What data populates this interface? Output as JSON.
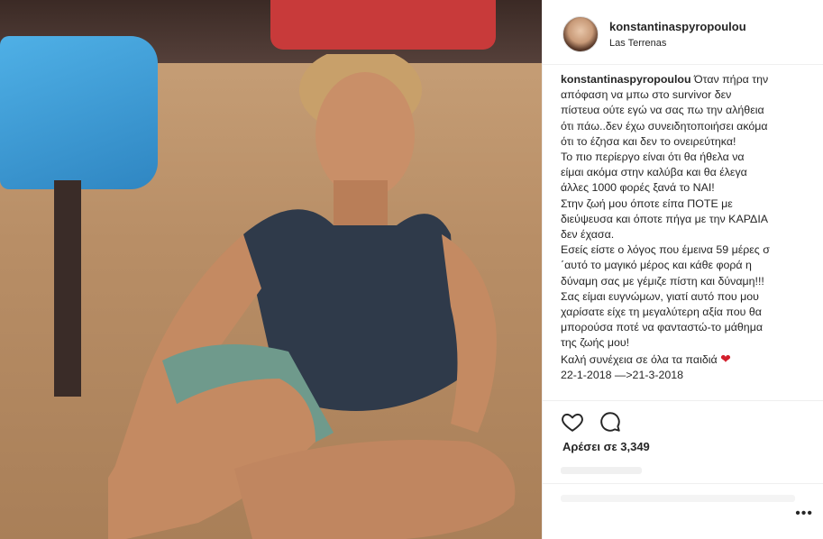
{
  "post": {
    "username": "konstantinaspyropoulou",
    "location": "Las Terrenas",
    "caption": {
      "user": "konstantinaspyropoulou",
      "lines": [
        "Όταν πήρα την",
        "απόφαση να μπω στο survivor δεν",
        "πίστευα ούτε εγώ να σας πω την αλήθεια",
        "ότι πάω..δεν έχω συνειδητοποιήσει ακόμα",
        "ότι το έζησα και δεν το ονειρεύτηκα!",
        "Το πιο περίεργο είναι ότι θα ήθελα να",
        "είμαι ακόμα στην καλύβα και θα έλεγα",
        "άλλες 1000 φορές ξανά το ΝΑΙ!",
        "Στην ζωή μου όποτε είπα ΠΟΤΕ με",
        "διεύψευσα και όποτε πήγα με την ΚΑΡΔΙΑ",
        "δεν έχασα.",
        "Εσείς είστε ο λόγος που έμεινα 59 μέρες σ",
        "΄αυτό το μαγικό μέρος και κάθε φορά η",
        "δύναμη σας με γέμιζε πίστη και δύναμη!!!",
        "Σας είμαι ευγνώμων, γιατί αυτό που μου",
        "χαρίσατε είχε τη μεγαλύτερη αξία που θα",
        "μπορούσα ποτέ να φανταστώ-το μάθημα",
        "της ζωής μου!",
        "Καλή συνέχεια σε όλα τα παιδιά",
        "22-1-2018 —>21-3-2018"
      ],
      "heart": "❤"
    },
    "likes_text": "Αρέσει σε 3,349",
    "more_text": "•••"
  },
  "icons": {
    "like": "heart-outline-icon",
    "comment": "speech-bubble-icon"
  },
  "colors": {
    "heart_red": "#d31f2c",
    "border": "#efefef"
  }
}
